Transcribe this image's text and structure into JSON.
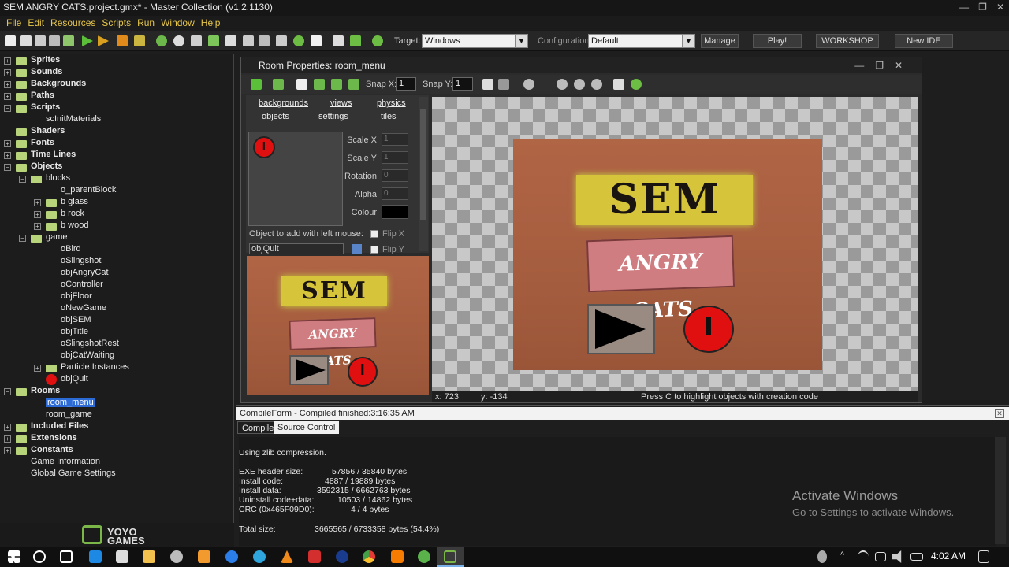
{
  "window": {
    "title": "SEM ANGRY CATS.project.gmx*  -  Master Collection (v1.2.1130)"
  },
  "menu": [
    "File",
    "Edit",
    "Resources",
    "Scripts",
    "Run",
    "Window",
    "Help"
  ],
  "toolbar": {
    "target_label": "Target:",
    "target_value": "Windows",
    "configuration_label": "Configuration:",
    "configuration_value": "Default",
    "manage_label": "Manage",
    "play_label": "Play!",
    "workshop_label": "WORKSHOP",
    "newide_label": "New IDE"
  },
  "tree": {
    "sprites": "Sprites",
    "sounds": "Sounds",
    "backgrounds": "Backgrounds",
    "paths": "Paths",
    "scripts": "Scripts",
    "scinit": "scInitMaterials",
    "shaders": "Shaders",
    "fonts": "Fonts",
    "timelines": "Time Lines",
    "objects": "Objects",
    "blocks": "blocks",
    "parentblock": "o_parentBlock",
    "bglass": "b glass",
    "brock": "b rock",
    "bwood": "b wood",
    "game": "game",
    "obird": "oBird",
    "oslingshot": "oSlingshot",
    "objangrycat": "objAngryCat",
    "ocontroller": "oController",
    "objfloor": "objFloor",
    "onewgame": "oNewGame",
    "objsem": "objSEM",
    "objtitle": "objTitle",
    "oslingshotrest": "oSlingshotRest",
    "objcatwaiting": "objCatWaiting",
    "particles": "Particle Instances",
    "objquit": "objQuit",
    "rooms": "Rooms",
    "roommenu": "room_menu",
    "roomgame": "room_game",
    "included": "Included Files",
    "extensions": "Extensions",
    "constants": "Constants",
    "gameinfo": "Game Information",
    "globalsettings": "Global Game Settings"
  },
  "logo": {
    "text": "YOYO GAMES"
  },
  "room": {
    "title": "Room Properties: room_menu",
    "snapx_label": "Snap X:",
    "snapx_value": "1",
    "snapy_label": "Snap Y:",
    "snapy_value": "1",
    "tabs": {
      "backgrounds": "backgrounds",
      "views": "views",
      "physics": "physics",
      "objects": "objects",
      "settings": "settings",
      "tiles": "tiles"
    },
    "scalex_label": "Scale X",
    "scalex_value": "1",
    "scaley_label": "Scale Y",
    "scaley_value": "1",
    "rotation_label": "Rotation",
    "rotation_value": "0",
    "alpha_label": "Alpha",
    "alpha_value": "0",
    "colour_label": "Colour",
    "object_add_label": "Object to add with left mouse:",
    "object_value": "objQuit",
    "flipx_label": "Flip X",
    "flipy_label": "Flip Y",
    "coord_x": "x: 723",
    "coord_y": "y: -134",
    "hint": "Press C to highlight objects with creation code",
    "sem_text": "SEM",
    "cats_text": "ANGRY CATS"
  },
  "compile": {
    "title": "CompileForm - Compiled finished:3:16:35 AM",
    "tab_compile": "Compile",
    "tab_source": "Source Control",
    "lines": {
      "zlib": "Using zlib compression.",
      "exe_label": "EXE header size:",
      "exe_value": "57856 / 35840 bytes",
      "install_code_label": "Install code:",
      "install_code_value": "4887 / 19889 bytes",
      "install_data_label": "Install data:",
      "install_data_value": "3592315 / 6662763 bytes",
      "uninstall_label": "Uninstall code+data:",
      "uninstall_value": "10503 / 14862 bytes",
      "crc_label": "CRC (0x465F09D0):",
      "crc_value": "4 / 4 bytes",
      "total_label": "Total size:",
      "total_value": "3665565 / 6733358 bytes (54.4%)"
    }
  },
  "watermark": {
    "line1": "Activate Windows",
    "line2": "Go to Settings to activate Windows."
  },
  "taskbar": {
    "time": "4:02 AM"
  }
}
